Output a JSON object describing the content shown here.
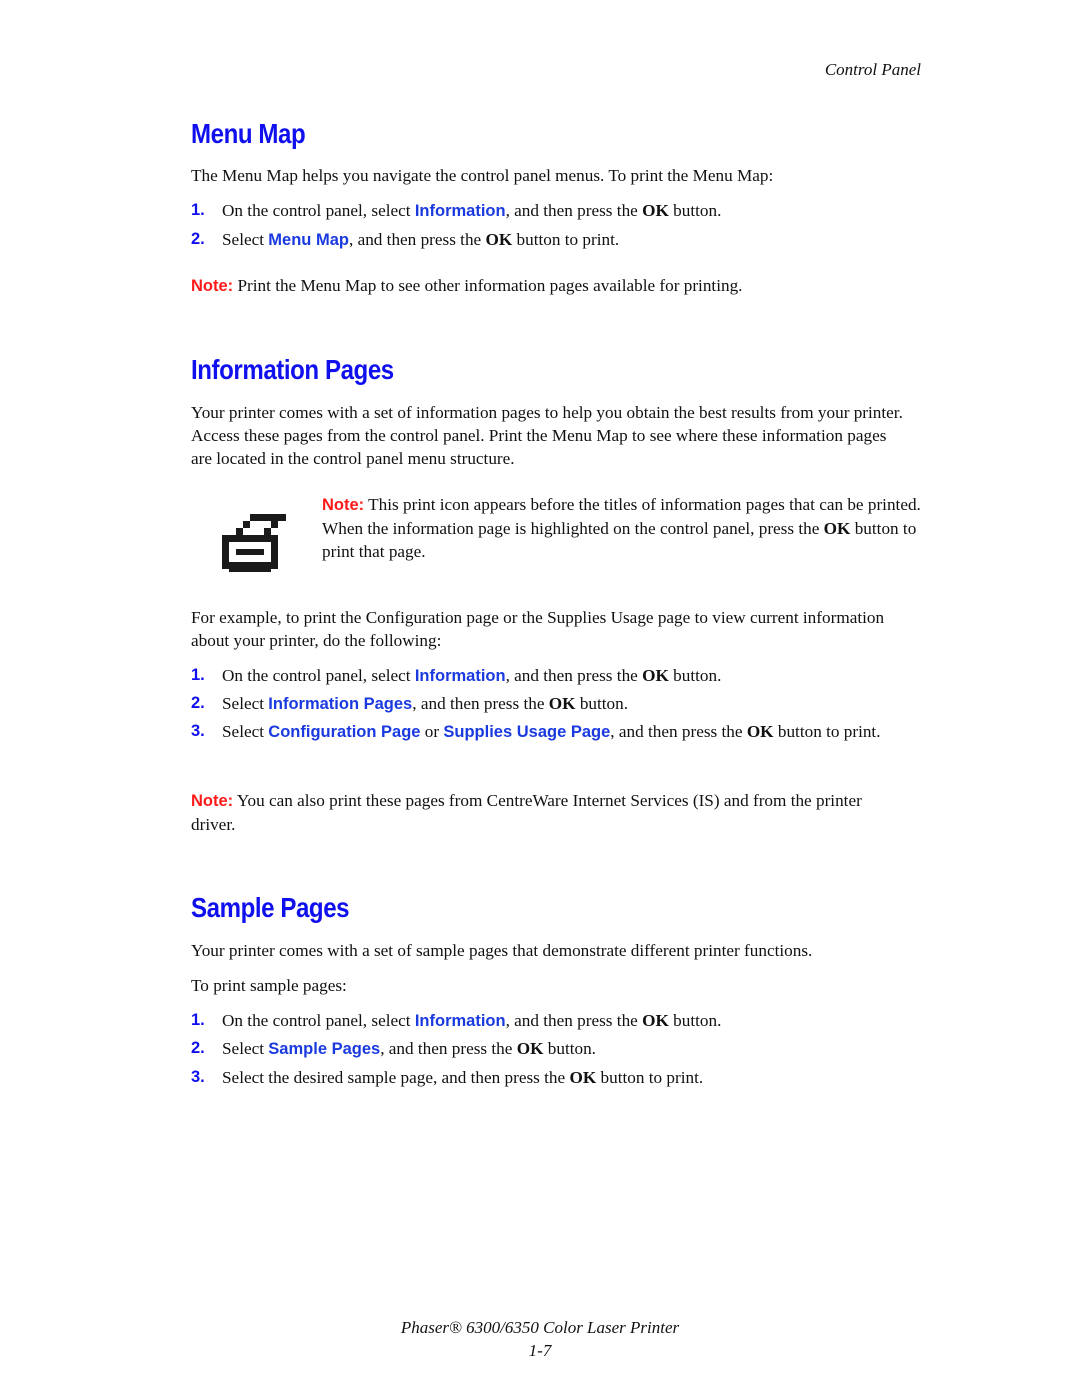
{
  "running_head": "Control Panel",
  "sections": {
    "menu_map": {
      "title": "Menu Map",
      "intro": "The Menu Map helps you navigate the control panel menus. To print the Menu Map:",
      "steps": [
        {
          "num": "1.",
          "pre": "On the control panel, select ",
          "ui": "Information",
          "mid": ", and then press the ",
          "ok": "OK",
          "post": " button."
        },
        {
          "num": "2.",
          "pre": "Select ",
          "ui": "Menu Map",
          "mid": ", and then press the ",
          "ok": "OK",
          "post": " button to print."
        }
      ],
      "note_label": "Note:",
      "note_text": " Print the Menu Map to see other information pages available for printing."
    },
    "information_pages": {
      "title": "Information Pages",
      "intro": "Your printer comes with a set of information pages to help you obtain the best results from your printer. Access these pages from the control panel. Print the Menu Map to see where these information pages are located in the control panel menu structure.",
      "icon_note": {
        "label": "Note:",
        "text_pre": " This print icon appears before the titles of information pages that can be printed. When the information page is highlighted on the control panel, press the ",
        "ok": "OK",
        "text_post": " button to print that page."
      },
      "example": "For example, to print the Configuration page or the Supplies Usage page to view current information about your printer, do the following:",
      "steps": [
        {
          "num": "1.",
          "pre": "On the control panel, select ",
          "ui": "Information",
          "mid": ", and then press the ",
          "ok": "OK",
          "post": " button."
        },
        {
          "num": "2.",
          "pre": "Select ",
          "ui": "Information Pages",
          "mid": ", and then press the ",
          "ok": "OK",
          "post": " button."
        },
        {
          "num": "3.",
          "pre": "Select ",
          "ui": "Configuration Page",
          "or": " or ",
          "ui2": "Supplies Usage Page",
          "mid": ", and then press the ",
          "ok": "OK",
          "post": " button to print."
        }
      ],
      "note_label": "Note:",
      "note_text": " You can also print these pages from CentreWare Internet Services (IS) and from the printer driver."
    },
    "sample_pages": {
      "title": "Sample Pages",
      "intro": "Your printer comes with a set of sample pages that demonstrate different printer functions.",
      "lead": "To print sample pages:",
      "steps": [
        {
          "num": "1.",
          "pre": "On the control panel, select ",
          "ui": "Information",
          "mid": ", and then press the ",
          "ok": "OK",
          "post": " button."
        },
        {
          "num": "2.",
          "pre": "Select ",
          "ui": "Sample Pages",
          "mid": ", and then press the ",
          "ok": "OK",
          "post": " button."
        },
        {
          "num": "3.",
          "pre": "Select the desired sample page, and then press the ",
          "ok": "OK",
          "post": " button to print."
        }
      ]
    }
  },
  "footer": {
    "product": "Phaser® 6300/6350 Color Laser Printer",
    "page_number": "1-7"
  },
  "icons": {
    "print_icon": "printer-pixel-icon"
  },
  "colors": {
    "heading": "#1010ee",
    "ui_term": "#1a3adf",
    "note": "#ff1a1a",
    "text": "#111111"
  }
}
